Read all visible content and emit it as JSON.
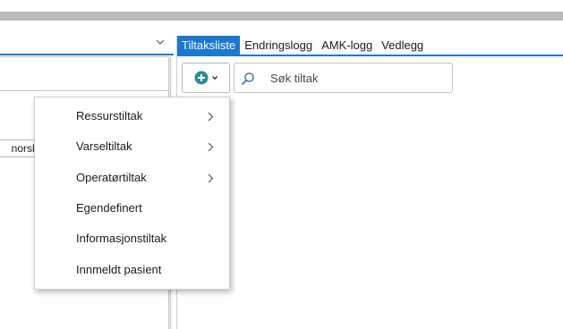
{
  "left_panel": {
    "field_text": "norsk"
  },
  "tabs": [
    {
      "label": "Tiltaksliste",
      "active": true
    },
    {
      "label": "Endringslogg",
      "active": false
    },
    {
      "label": "AMK-logg",
      "active": false
    },
    {
      "label": "Vedlegg",
      "active": false
    }
  ],
  "toolbar": {
    "add_icon": "plus-circle-icon",
    "search": {
      "placeholder": "Søk tiltak",
      "value": "",
      "icon": "search-icon"
    }
  },
  "menu": {
    "items": [
      {
        "label": "Ressurstiltak",
        "has_submenu": true
      },
      {
        "label": "Varseltiltak",
        "has_submenu": true
      },
      {
        "label": "Operatørtiltak",
        "has_submenu": true
      },
      {
        "label": "Egendefinert",
        "has_submenu": false
      },
      {
        "label": "Informasjonstiltak",
        "has_submenu": false
      },
      {
        "label": "Innmeldt pasient",
        "has_submenu": false
      }
    ]
  },
  "colors": {
    "accent": "#1a78d0",
    "add_icon": "#2d8c95",
    "top_strip": "#b9b9b9"
  }
}
